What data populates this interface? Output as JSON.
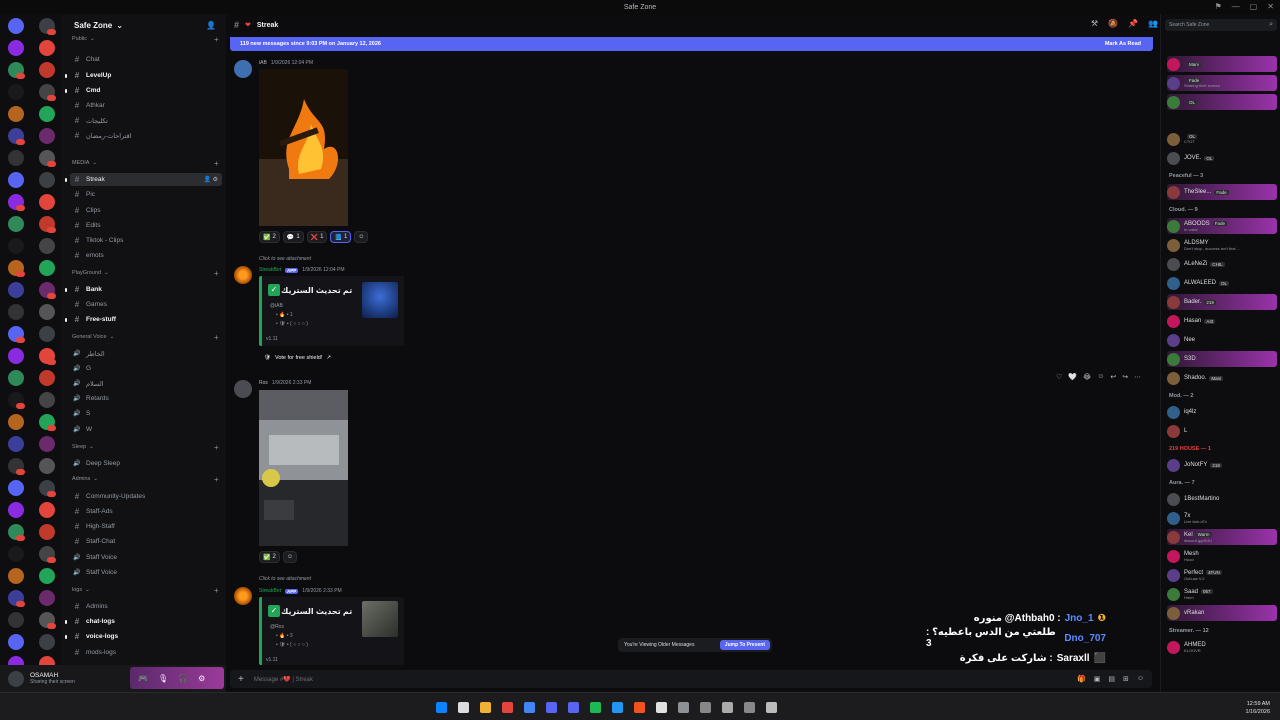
{
  "window": {
    "title": "Safe Zone"
  },
  "server": {
    "name": "Safe Zone"
  },
  "channel_groups": [
    {
      "name": "Public",
      "channels": [
        {
          "name": "Chat",
          "type": "text"
        },
        {
          "name": "LevelUp",
          "type": "text",
          "unread": true
        },
        {
          "name": "Cmd",
          "type": "text",
          "unread": true
        },
        {
          "name": "Athkar",
          "type": "text"
        },
        {
          "name": "تكليجات",
          "type": "text"
        },
        {
          "name": "اقتراحات-رمضان",
          "type": "text"
        }
      ]
    },
    {
      "name": "MEDIA",
      "channels": [
        {
          "name": "Streak",
          "type": "text",
          "active": true
        },
        {
          "name": "Pic",
          "type": "text"
        },
        {
          "name": "Clips",
          "type": "text"
        },
        {
          "name": "Edits",
          "type": "text"
        },
        {
          "name": "Tiktok - Clips",
          "type": "text"
        },
        {
          "name": "emots",
          "type": "text"
        }
      ]
    },
    {
      "name": "PlayGround",
      "channels": [
        {
          "name": "Bank",
          "type": "text",
          "unread": true
        },
        {
          "name": "Games",
          "type": "text"
        },
        {
          "name": "Free-stuff",
          "type": "text",
          "unread": true
        }
      ]
    },
    {
      "name": "General Voice",
      "channels": [
        {
          "name": "الخاطر",
          "type": "voice"
        },
        {
          "name": "G",
          "type": "voice"
        },
        {
          "name": "السلام",
          "type": "voice"
        },
        {
          "name": "Retards",
          "type": "voice"
        },
        {
          "name": "S",
          "type": "voice"
        },
        {
          "name": "W",
          "type": "voice"
        }
      ]
    },
    {
      "name": "Sleep",
      "channels": [
        {
          "name": "Deep Sleep",
          "type": "voice"
        }
      ]
    },
    {
      "name": "Admins",
      "channels": [
        {
          "name": "Community-Updates",
          "type": "text"
        },
        {
          "name": "Staff-Ads",
          "type": "text"
        },
        {
          "name": "High-Staff",
          "type": "text"
        },
        {
          "name": "Staff-Chat",
          "type": "text"
        },
        {
          "name": "Staff Voice",
          "type": "voice"
        },
        {
          "name": "Staff Voice",
          "type": "voice"
        }
      ]
    },
    {
      "name": "logs",
      "channels": [
        {
          "name": "Admins",
          "type": "text"
        },
        {
          "name": "chat-logs",
          "type": "text",
          "unread": true
        },
        {
          "name": "voice-logs",
          "type": "text",
          "unread": true
        },
        {
          "name": "mods-logs",
          "type": "text"
        }
      ]
    }
  ],
  "user_panel": {
    "name": "OSAMAH",
    "status": "Sharing their screen"
  },
  "chat": {
    "channel_title": "Streak",
    "new_messages_banner": "119 new messages since 9:03 PM on January 12, 2026",
    "mark_as_read": "Mark As Read",
    "messages": [
      {
        "author": "iAB",
        "time": "1/9/2026 12:04 PM",
        "reactions": [
          {
            "emoji": "✅",
            "count": "2"
          },
          {
            "emoji": "💬",
            "count": "1"
          },
          {
            "emoji": "❌",
            "count": "1"
          },
          {
            "emoji": "📘",
            "count": "1"
          }
        ]
      },
      {
        "reply_text": "Click to see attachment",
        "author": "StreakBot",
        "bot_tag": "APP",
        "time": "1/9/2026 12:04 PM",
        "embed_title": "تم تحديث الستريك •",
        "embed_mention": "@iAB",
        "embed_line1": "• 🔥 • 1",
        "embed_line2": "• 🛡 • ( ○ ○ ○ )",
        "embed_footer": "v1.11",
        "vote_text": "Vote for free shield!"
      },
      {
        "author": "Ros",
        "time": "1/9/2026 2:33 PM",
        "reactions": [
          {
            "emoji": "✅",
            "count": "2"
          }
        ]
      },
      {
        "reply_text": "Click to see attachment",
        "author": "StreakBot",
        "bot_tag": "APP",
        "time": "1/9/2026 2:33 PM",
        "embed_title": "تم تحديث الستريك •",
        "embed_mention": "@Ros",
        "embed_line1": "• 🔥 • 3",
        "embed_line2": "• 🛡 • ( ○ ○ ○ )",
        "embed_footer": "v1.11"
      }
    ],
    "older_messages_notice": "You're Viewing Older Messages",
    "jump_to_present": "Jump To Present",
    "composer_placeholder": "Message #💔 | Streak"
  },
  "stream_overlay": [
    {
      "user": "Jno_1",
      "text": "منوره @Athbah0 :"
    },
    {
      "user": "Dno_707",
      "text": "طلعتي من الدس باعطيه؟ : 3"
    },
    {
      "user": "Saraxll",
      "text": "شاركت على فكرة :"
    }
  ],
  "members": {
    "search_placeholder": "Search Safe Zone",
    "sections": [
      {
        "title": "",
        "items": [
          {
            "name": "",
            "tag": "Mani"
          },
          {
            "name": "",
            "tag": "Fade",
            "status": "Sharing their screen"
          },
          {
            "name": "",
            "tag": "OL"
          }
        ]
      },
      {
        "title": "",
        "items": [
          {
            "name": "",
            "tag": "OL",
            "status": "CTOT"
          },
          {
            "name": "JOVE.",
            "tag": "OL"
          }
        ]
      },
      {
        "title": "Peaceful — 3",
        "items": [
          {
            "name": "TheSlee...",
            "tag": "Fade"
          }
        ]
      },
      {
        "title": "Cloud. — 9",
        "items": [
          {
            "name": "ABOODS",
            "tag": "Fade",
            "status": "In voice"
          },
          {
            "name": "ALDSMY",
            "status": "Don't stop , success isn't that ..."
          },
          {
            "name": "ALeNeZi",
            "tag": "CHIL"
          },
          {
            "name": "ALWALEED",
            "tag": "OL"
          },
          {
            "name": "Bader.",
            "tag": "219"
          },
          {
            "name": "Hasan",
            "tag": "A4t"
          },
          {
            "name": "Nee"
          },
          {
            "name": "S3D"
          },
          {
            "name": "Shadoo.",
            "tag": "Mani"
          }
        ]
      },
      {
        "title": "Mod. — 2",
        "items": [
          {
            "name": "iq4lz"
          },
          {
            "name": "L"
          }
        ]
      },
      {
        "title": "219 HOUSE — 1",
        "items": [
          {
            "name": "JoNotFY",
            "tag": "219"
          }
        ]
      },
      {
        "title": "Aura. — 7",
        "items": [
          {
            "name": "1BestMartino"
          },
          {
            "name": "7x",
            "status": "Live kick.d7x"
          },
          {
            "name": "Kel",
            "tag": "Warm",
            "status": "discord.gg/KUU"
          },
          {
            "name": "Mesh",
            "status": "Hood"
          },
          {
            "name": "Perfect",
            "tag": "4FUN",
            "status": "OutLaw V.2"
          },
          {
            "name": "Saad",
            "tag": "057",
            "status": "Hmm"
          },
          {
            "name": "vRakan"
          }
        ]
      },
      {
        "title": "Streamer. — 12",
        "items": [
          {
            "name": "AHMED",
            "status": "KLOOVR"
          }
        ]
      }
    ]
  },
  "taskbar": {
    "time": "12:59 AM",
    "date": "1/16/2026"
  },
  "colors": {
    "accent": "#5865f2",
    "green": "#23a559",
    "highlight": "#b43cc8"
  }
}
